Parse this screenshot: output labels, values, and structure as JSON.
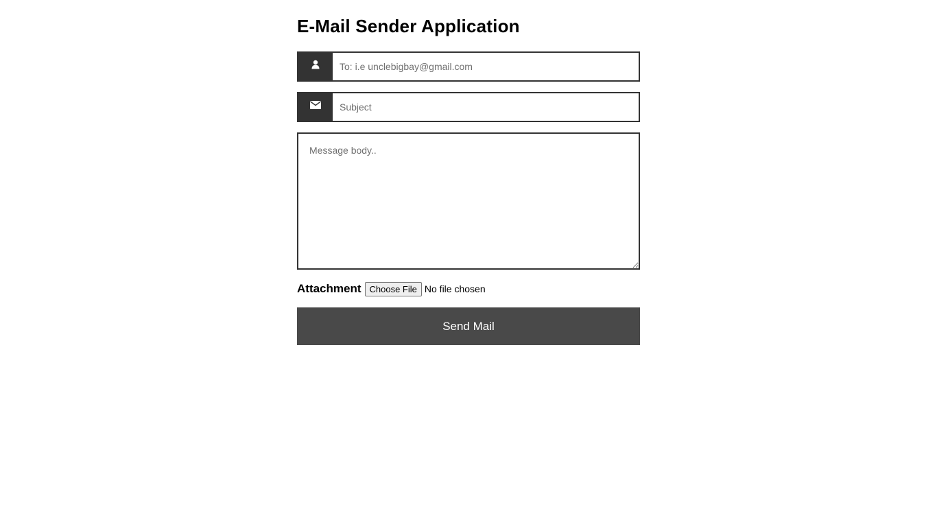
{
  "page": {
    "title": "E-Mail Sender Application"
  },
  "form": {
    "to": {
      "icon": "user-icon",
      "value": "",
      "placeholder": "To: i.e unclebigbay@gmail.com"
    },
    "subject": {
      "icon": "envelope-icon",
      "value": "",
      "placeholder": "Subject"
    },
    "message": {
      "value": "",
      "placeholder": "Message body.."
    },
    "attachment": {
      "label": "Attachment",
      "button_label": "Choose File",
      "status": "No file chosen"
    },
    "send_label": "Send Mail"
  },
  "colors": {
    "icon_bg": "#333333",
    "border": "#333333",
    "send_bg": "#494949",
    "send_text": "#ffffff"
  }
}
